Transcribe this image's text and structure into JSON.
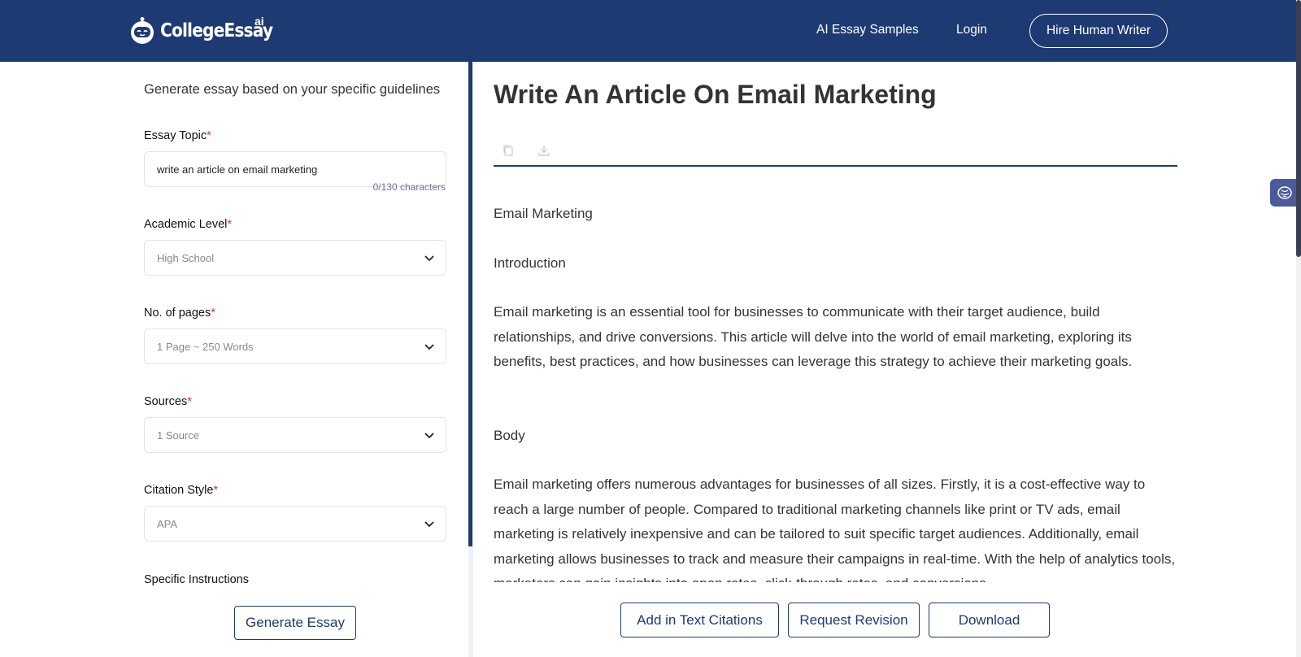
{
  "header": {
    "logo_text": "CollegeEssay",
    "logo_superscript": "ai",
    "nav": {
      "samples": "AI Essay Samples",
      "login": "Login",
      "hire": "Hire Human Writer"
    },
    "bg_color": "#1e3a72"
  },
  "form": {
    "intro": "Generate essay based on your specific guidelines",
    "required_mark": "*",
    "topic": {
      "label": "Essay Topic",
      "value": "write an article on email marketing",
      "counter": "0/130 characters"
    },
    "academic_level": {
      "label": "Academic Level",
      "value": "High School"
    },
    "pages": {
      "label": "No. of pages",
      "value": "1 Page ~ 250 Words"
    },
    "sources": {
      "label": "Sources",
      "value": "1 Source"
    },
    "citation": {
      "label": "Citation Style",
      "value": "APA"
    },
    "instructions": {
      "label": "Specific Instructions"
    },
    "generate_label": "Generate Essay"
  },
  "essay": {
    "title": "Write An Article On Email Marketing",
    "heading": "Email Marketing",
    "intro_heading": "Introduction",
    "intro_paragraph": "Email marketing is an essential tool for businesses to communicate with their target audience, build relationships, and drive conversions. This article will delve into the world of email marketing, exploring its benefits, best practices, and how businesses can leverage this strategy to achieve their marketing goals.",
    "body_heading": "Body",
    "body_paragraph": "Email marketing offers numerous advantages for businesses of all sizes. Firstly, it is a cost-effective way to reach a large number of people. Compared to traditional marketing channels like print or TV ads, email marketing is relatively inexpensive and can be tailored to suit specific target audiences. Additionally, email marketing allows businesses to track and measure their campaigns in real-time. With the help of analytics tools, marketers can gain insights into open rates, click-through rates, and conversions."
  },
  "actions": {
    "citations": "Add in Text Citations",
    "revision": "Request Revision",
    "download": "Download"
  },
  "icons": {
    "copy": "copy-icon",
    "download": "download-icon",
    "chevron": "chevron-down-icon",
    "brain": "brain-icon"
  }
}
